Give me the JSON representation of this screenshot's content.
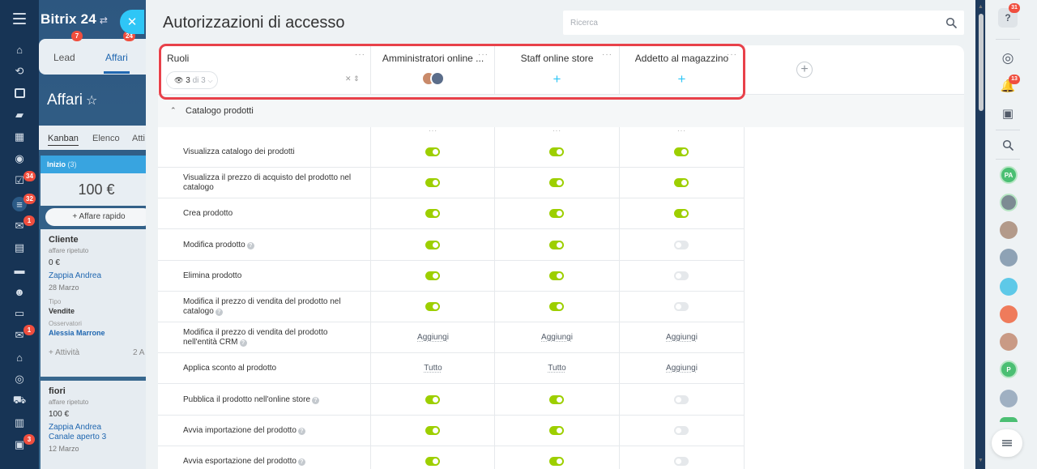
{
  "crm": {
    "brand": "Bitrix 24",
    "brand_swap": "⇄",
    "tabs": [
      {
        "label": "Lead",
        "badge": "7"
      },
      {
        "label": "Affari",
        "badge": "24"
      }
    ],
    "title": "Affari",
    "views": [
      "Kanban",
      "Elenco",
      "Atti"
    ],
    "stage": {
      "name": "Inizio",
      "count": "(3)",
      "sum": "100 €"
    },
    "quick_add": "Affare rapido",
    "nav_badges": [
      "34",
      "32",
      "1",
      "1",
      "3"
    ],
    "cards": [
      {
        "name": "Cliente",
        "sub": "affare ripetuto",
        "amount": "0 €",
        "contact": "Zappia Andrea",
        "date": "28 Marzo",
        "type_label": "Tipo",
        "type_value": "Vendite",
        "observers_label": "Osservatori",
        "observers_value": "Alessia Marrone",
        "activity": "+ Attività",
        "activity_count": "2 A"
      },
      {
        "name": "fiori",
        "sub": "affare ripetuto",
        "amount": "100 €",
        "contact": "Zappia Andrea",
        "channel": "Canale aperto 3",
        "date": "12 Marzo"
      }
    ]
  },
  "panel": {
    "title": "Autorizzazioni di accesso",
    "search_placeholder": "Ricerca",
    "roles_header": "Ruoli",
    "roles_pill_count": "3",
    "roles_pill_total": "di 3",
    "roles": [
      {
        "name": "Amministratori online ..."
      },
      {
        "name": "Staff online store"
      },
      {
        "name": "Addetto al magazzino"
      }
    ],
    "section": "Catalogo prodotti",
    "more_dots": "···",
    "rows": [
      {
        "label": "Visualizza catalogo dei prodotti",
        "help": false,
        "values": [
          "on",
          "on",
          "on"
        ]
      },
      {
        "label": "Visualizza il prezzo di acquisto del prodotto nel catalogo",
        "help": false,
        "values": [
          "on",
          "on",
          "on"
        ]
      },
      {
        "label": "Crea prodotto",
        "help": false,
        "values": [
          "on",
          "on",
          "on"
        ]
      },
      {
        "label": "Modifica prodotto",
        "help": true,
        "values": [
          "on",
          "on",
          "off"
        ]
      },
      {
        "label": "Elimina prodotto",
        "help": false,
        "values": [
          "on",
          "on",
          "off"
        ]
      },
      {
        "label": "Modifica il prezzo di vendita del prodotto nel catalogo",
        "help": true,
        "values": [
          "on",
          "on",
          "off"
        ]
      },
      {
        "label": "Modifica il prezzo di vendita del prodotto nell'entità CRM",
        "help": true,
        "values": [
          "Aggiungi",
          "Aggiungi",
          "Aggiungi"
        ]
      },
      {
        "label": "Applica sconto al prodotto",
        "help": false,
        "values": [
          "Tutto",
          "Tutto",
          "Aggiungi"
        ]
      },
      {
        "label": "Pubblica il prodotto nell'online store",
        "help": true,
        "values": [
          "on",
          "on",
          "off"
        ]
      },
      {
        "label": "Avvia importazione del prodotto",
        "help": true,
        "values": [
          "on",
          "on",
          "off"
        ]
      },
      {
        "label": "Avvia esportazione del prodotto",
        "help": true,
        "values": [
          "on",
          "on",
          "off"
        ]
      }
    ]
  },
  "rightbar": {
    "help_badge": "31",
    "notif_badge": "13",
    "user_initials": [
      "PA",
      "P"
    ]
  },
  "colors": {
    "accent": "#2fc6f6",
    "toggle_on": "#9dcf00",
    "toggle_off": "#e5e8eb",
    "highlight": "#e8414a",
    "badge": "#f04e3e"
  }
}
